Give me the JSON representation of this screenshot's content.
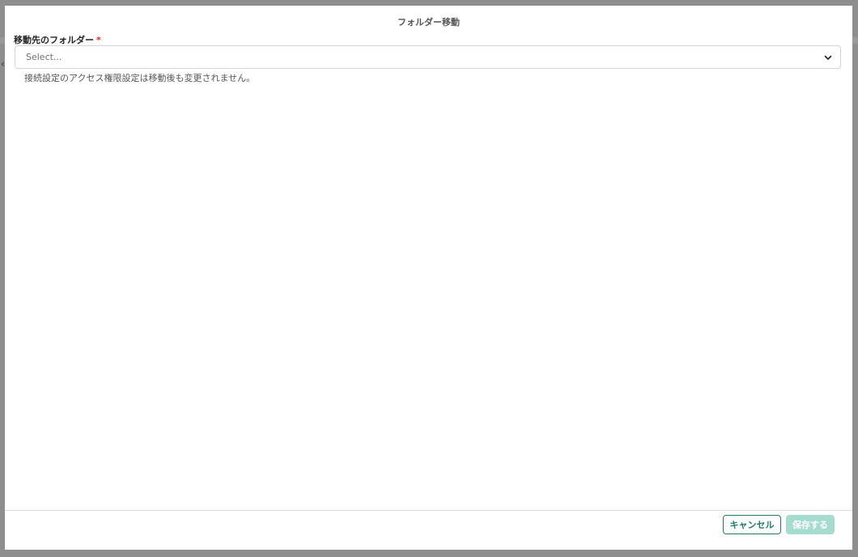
{
  "dialog": {
    "title": "フォルダー移動"
  },
  "field": {
    "label": "移動先のフォルダー",
    "required_mark": "*",
    "placeholder": "Select...",
    "help_text": "接続設定のアクセス権限設定は移動後も変更されません。"
  },
  "footer": {
    "cancel_label": "キャンセル",
    "save_label": "保存する"
  },
  "icons": {
    "select_chevron": "chevron-down-icon",
    "back": "chevron-left-icon"
  },
  "colors": {
    "accent": "#1d7a68",
    "accent_disabled": "#a6dcd0",
    "required": "#d93025"
  }
}
